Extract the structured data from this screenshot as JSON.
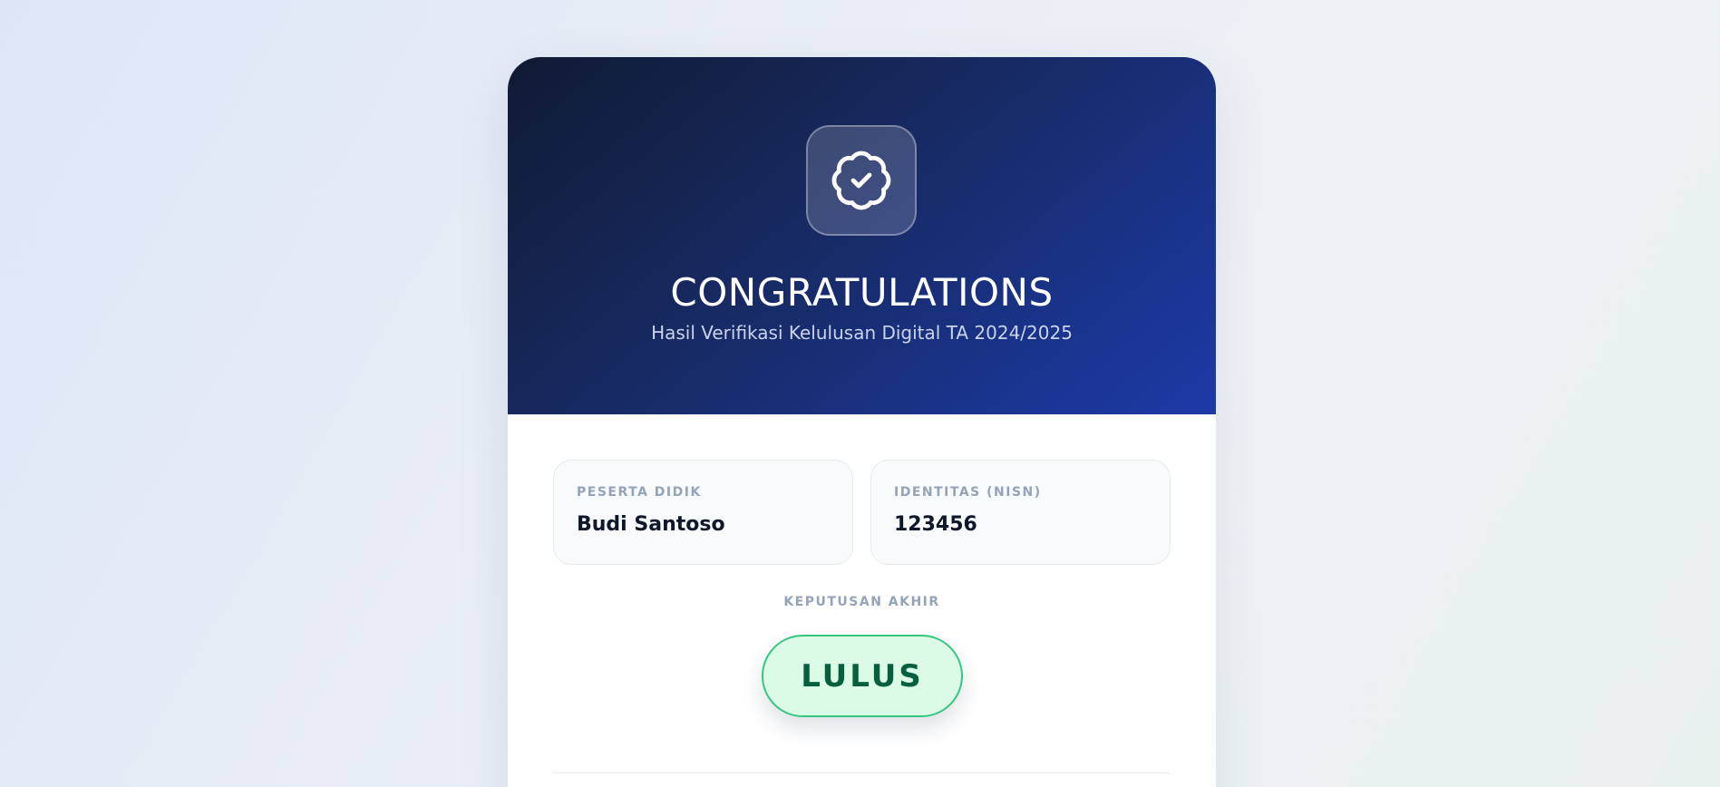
{
  "header": {
    "title": "CONGRATULATIONS",
    "subtitle": "Hasil Verifikasi Kelulusan Digital TA 2024/2025",
    "badge_icon": "verified-badge-icon"
  },
  "student": {
    "name_label": "PESERTA DIDIK",
    "name_value": "Budi Santoso",
    "id_label": "IDENTITAS (NISN)",
    "id_value": "123456"
  },
  "decision": {
    "label": "KEPUTUSAN AKHIR",
    "status": "LULUS",
    "status_color": "#065f3e"
  },
  "colors": {
    "hero_start": "#111a33",
    "hero_end": "#1c3aa8",
    "success_bg": "#dcfbe7",
    "success_border": "#34c77f"
  }
}
